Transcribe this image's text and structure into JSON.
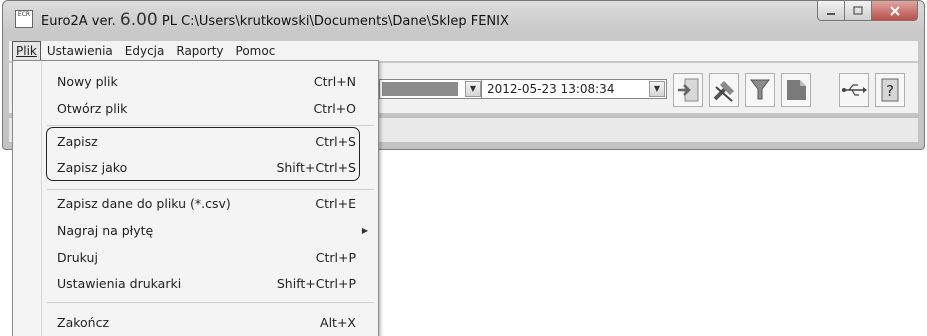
{
  "window": {
    "title_prefix": "Euro2A ver. ",
    "version": "6.00",
    "title_suffix": " PL   C:\\Users\\krutkowski\\Documents\\Dane\\Sklep FENIX",
    "app_icon_text": "ECR"
  },
  "menubar": {
    "items": [
      {
        "label": "Plik"
      },
      {
        "label": "Ustawienia"
      },
      {
        "label": "Edycja"
      },
      {
        "label": "Raporty"
      },
      {
        "label": "Pomoc"
      }
    ]
  },
  "toolbar": {
    "datetime": "2012-05-23 13:08:34",
    "icons": [
      "import-icon",
      "tools-icon",
      "filter-icon",
      "report-icon",
      "usb-icon",
      "help-icon"
    ]
  },
  "file_menu": {
    "items": [
      {
        "label": "Nowy plik",
        "shortcut": "Ctrl+N"
      },
      {
        "label": "Otwórz plik",
        "shortcut": "Ctrl+O"
      },
      {
        "label": "Zapisz",
        "shortcut": "Ctrl+S"
      },
      {
        "label": "Zapisz jako",
        "shortcut": "Shift+Ctrl+S"
      },
      {
        "label": "Zapisz dane do pliku (*.csv)",
        "shortcut": "Ctrl+E"
      },
      {
        "label": "Nagraj na płytę",
        "shortcut": ""
      },
      {
        "label": "Drukuj",
        "shortcut": "Ctrl+P"
      },
      {
        "label": "Ustawienia drukarki",
        "shortcut": "Shift+Ctrl+P"
      },
      {
        "label": "Zakończ",
        "shortcut": "Alt+X"
      }
    ]
  }
}
